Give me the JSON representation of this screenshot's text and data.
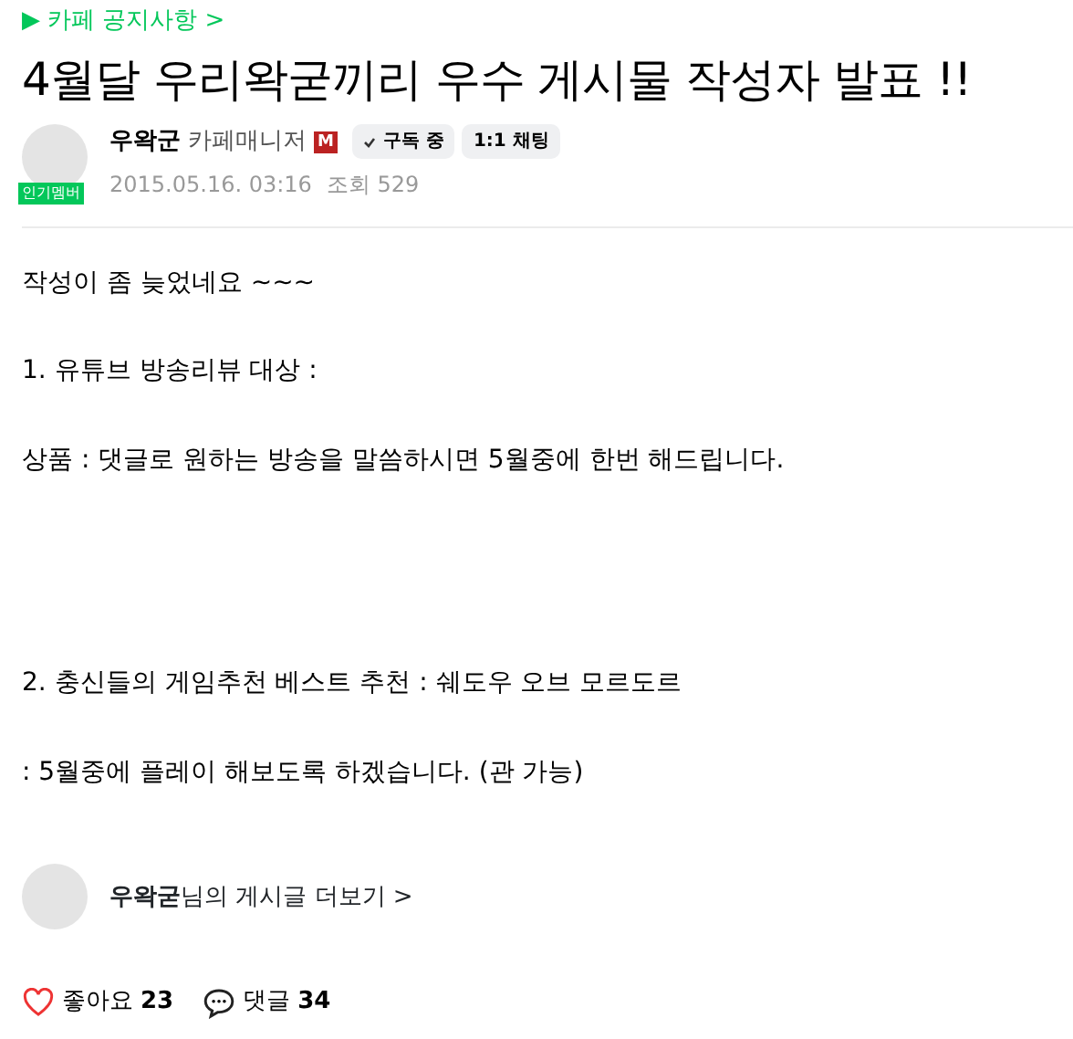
{
  "board_link": {
    "icon": "▶",
    "label": "카페 공지사항",
    "chevron": ">"
  },
  "title": "4월달 우리왁굳끼리 우수 게시물 작성자 발표 !!",
  "author": {
    "name": "우왁군",
    "role": "카페매니저",
    "role_badge": "M",
    "avatar_badge": "인기멤버",
    "subscribe": "구독 중",
    "chat": "1:1 채팅",
    "date": "2015.05.16. 03:16",
    "views_label": "조회",
    "views": "529"
  },
  "paragraphs": [
    {
      "text": "작성이 좀 늦었네요 ~~~"
    },
    {
      "text": "1. 유튜브 방송리뷰 대상 :"
    },
    {
      "text": "상품 : 댓글로 원하는 방송을 말씀하시면 5월중에 한번 해드립니다."
    },
    {
      "text": "2. 충신들의 게임추천 베스트 추천 : 쉐도우 오브 모르도르"
    },
    {
      "text": ": 5월중에 플레이 해보도록 하겠습니다. (관 가능)"
    }
  ],
  "more_posts": {
    "name": "우왁굳",
    "suffix": "님의 게시글 더보기",
    "chevron": ">"
  },
  "reactions": {
    "like_label": "좋아요",
    "like_count": "23",
    "comment_label": "댓글",
    "comment_count": "34"
  }
}
